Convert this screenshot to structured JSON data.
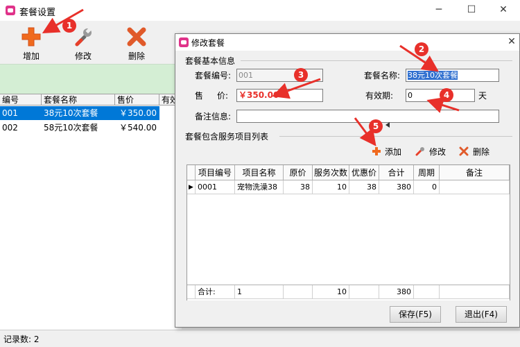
{
  "main": {
    "title": "套餐设置",
    "window_controls": {
      "minimize": "─",
      "maximize": "☐",
      "close": "✕"
    },
    "toolbar": {
      "add": "增加",
      "edit": "修改",
      "delete": "删除"
    },
    "grid": {
      "headers": [
        "编号",
        "套餐名称",
        "售价",
        "有效"
      ],
      "rows": [
        {
          "id": "001",
          "name": "38元10次套餐",
          "price": "￥350.00",
          "selected": true
        },
        {
          "id": "002",
          "name": "58元10次套餐",
          "price": "￥540.00",
          "selected": false
        }
      ]
    },
    "status_label": "记录数: 2"
  },
  "dialog": {
    "title": "修改套餐",
    "close": "✕",
    "basic_section": "套餐基本信息",
    "code_label": "套餐编号:",
    "code_value": "001",
    "name_label": "套餐名称:",
    "name_value": "38元10次套餐",
    "price_label_1": "售",
    "price_label_2": "价:",
    "price_value": "￥350.00",
    "validity_label": "有效期:",
    "validity_value": "0",
    "validity_unit": "天",
    "remark_label": "备注信息:",
    "remark_value": "",
    "items_section": "套餐包含服务项目列表",
    "item_actions": {
      "add": "添加",
      "edit": "修改",
      "delete": "删除"
    },
    "items_grid": {
      "headers": [
        "项目编号",
        "项目名称",
        "原价",
        "服务次数",
        "优惠价",
        "合计",
        "周期",
        "备注"
      ],
      "rows": [
        [
          "0001",
          "宠物洗澡38",
          "38",
          "10",
          "38",
          "380",
          "0",
          ""
        ]
      ],
      "footer": [
        "合计:",
        "1",
        "",
        "10",
        "",
        "380",
        "",
        ""
      ]
    },
    "save_button": "保存(F5)",
    "exit_button": "退出(F4)"
  },
  "annotations": [
    "1",
    "2",
    "3",
    "4",
    "5"
  ],
  "colors": {
    "annotation": "#e8302a",
    "selection": "#0078d7",
    "price_text": "#e8302a",
    "strip": "#d4eed4"
  }
}
